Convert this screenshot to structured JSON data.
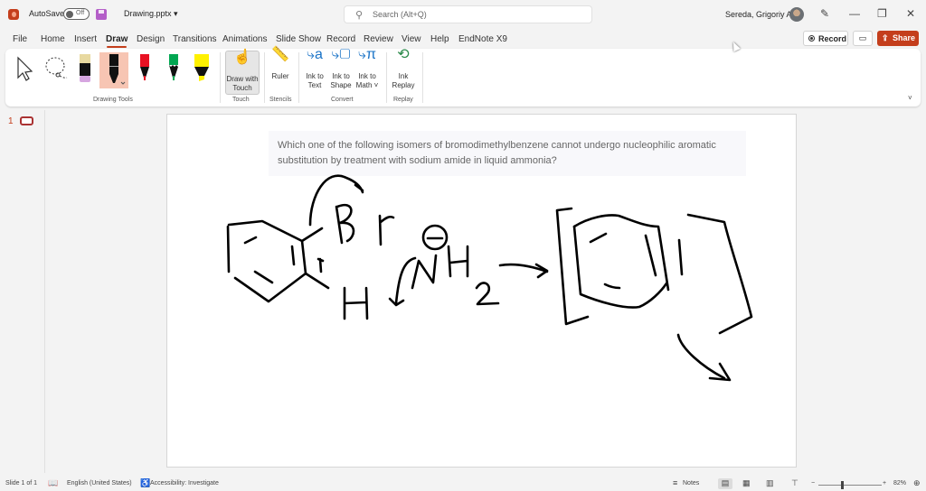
{
  "titlebar": {
    "autosave_label": "AutoSave",
    "autosave_state": "Off",
    "filename": "Drawing.pptx",
    "filename_chevron": "▾",
    "search_placeholder": "Search (Alt+Q)",
    "user_name": "Sereda, Grigoriy A",
    "window_buttons": {
      "pen": "✎",
      "minimize": "—",
      "restore": "❐",
      "close": "✕"
    }
  },
  "menu": {
    "tabs": [
      "File",
      "Home",
      "Insert",
      "Draw",
      "Design",
      "Transitions",
      "Animations",
      "Slide Show",
      "Record",
      "Review",
      "View",
      "Help",
      "EndNote X9"
    ],
    "active_tab": "Draw",
    "record_label": "Record",
    "share_label": "Share",
    "comment_icon": "▭"
  },
  "ribbon": {
    "groups": {
      "drawing_tools": "Drawing Tools",
      "touch": "Touch",
      "stencils": "Stencils",
      "convert": "Convert",
      "replay": "Replay"
    },
    "pens": [
      {
        "name": "eraser",
        "color": "#e8d9a0",
        "tip": "#d6a6e0"
      },
      {
        "name": "black-pen",
        "color": "#000000",
        "selected": true
      },
      {
        "name": "red-pen",
        "color": "#e81123"
      },
      {
        "name": "green-pen",
        "color": "#00a651"
      },
      {
        "name": "yellow-highlighter",
        "color": "#fff100"
      }
    ],
    "buttons": {
      "draw_with_touch": "Draw with Touch",
      "ruler": "Ruler",
      "ink_to_text": "Ink to Text",
      "ink_to_shape": "Ink to Shape",
      "ink_to_math": "Ink to Math ˅",
      "ink_replay": "Ink Replay"
    },
    "collapse_icon": "˅"
  },
  "thumbnails": {
    "slide_number": "1"
  },
  "slide": {
    "question": "Which one of the following isomers of bromodimethylbenzene cannot undergo nucleophilic aromatic substitution by treatment with sodium amide in liquid ammonia?"
  },
  "statusbar": {
    "slide_info": "Slide 1 of 1",
    "language": "English (United States)",
    "accessibility": "Accessibility: Investigate",
    "notes": "Notes",
    "zoom_level": "82%",
    "zoom_minus": "−",
    "zoom_plus": "+"
  }
}
